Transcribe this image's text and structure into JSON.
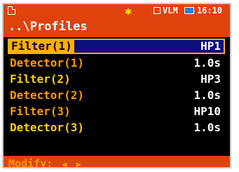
{
  "status": {
    "icon": "document-icon",
    "star": "✱",
    "vlm": "VLM",
    "time": "16:10"
  },
  "path": "..\\Profiles",
  "rows": [
    {
      "label": "Filter(1)",
      "value": "HP1"
    },
    {
      "label": "Detector(1)",
      "value": "1.0s"
    },
    {
      "label": "Filter(2)",
      "value": "HP3"
    },
    {
      "label": "Detector(2)",
      "value": "1.0s"
    },
    {
      "label": "Filter(3)",
      "value": "HP10"
    },
    {
      "label": "Detector(3)",
      "value": "1.0s"
    }
  ],
  "footer": {
    "label": "Modify:",
    "left_arrow": "◀",
    "right_arrow": "▶"
  },
  "colors": {
    "accent": "#e0420e",
    "selection_border": "#ffb000",
    "selection_fill": "#0b0f7a"
  }
}
